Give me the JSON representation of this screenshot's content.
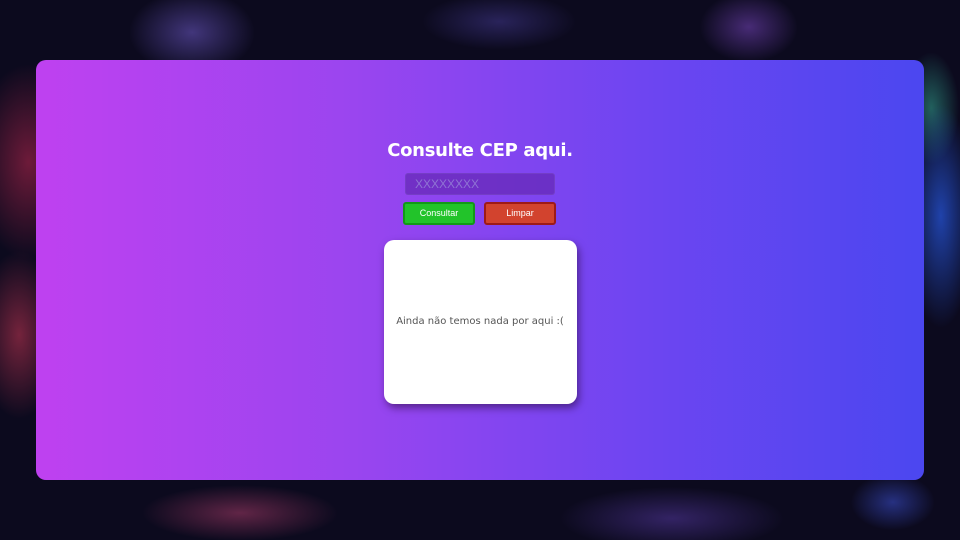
{
  "page": {
    "title": "Consulte CEP aqui."
  },
  "search": {
    "placeholder": "XXXXXXXX",
    "value": ""
  },
  "actions": {
    "consultar_label": "Consultar",
    "limpar_label": "Limpar"
  },
  "result": {
    "empty_message": "Ainda não temos nada por aqui :("
  },
  "colors": {
    "card_gradient_start": "#bf41f0",
    "card_gradient_end": "#4b47f0",
    "consultar_button": "#22c32a",
    "limpar_button": "#d2432e",
    "result_box": "#ffffff"
  }
}
